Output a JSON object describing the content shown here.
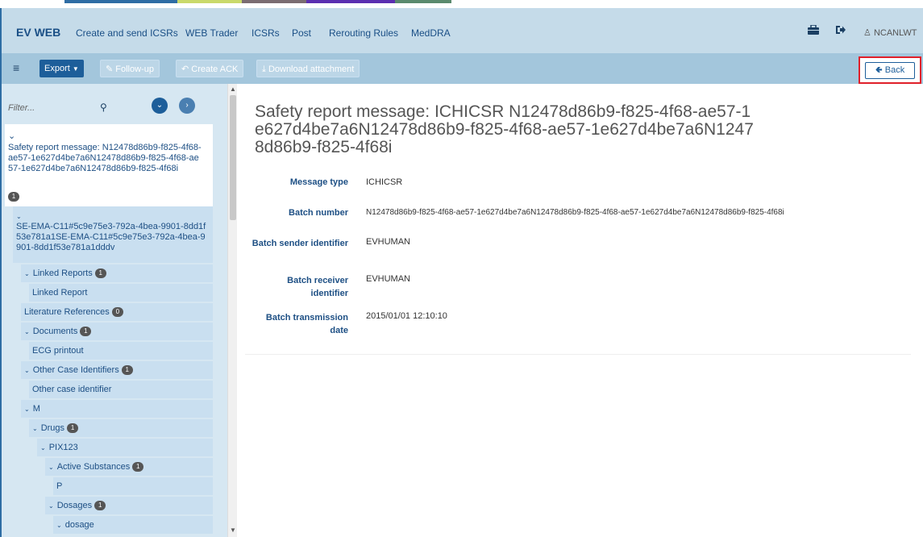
{
  "colors": {
    "nav_bg": "#c5dbe9",
    "toolbar_bg": "#a3c6dc",
    "sidebar_bg": "#d6e7f2",
    "primary": "#1d5e9a",
    "highlight_border": "#e0202a",
    "top_strip": [
      "#2e6da4",
      "#c9d96b",
      "#7a6c72",
      "#5b2fb0",
      "#5a8a6e"
    ]
  },
  "nav": {
    "brand": "EV WEB",
    "links": [
      "Create and send ICSRs",
      "WEB Trader",
      "ICSRs",
      "Post",
      "Rerouting Rules",
      "MedDRA"
    ],
    "user": "NCANLWT",
    "icons": [
      "briefcase-icon",
      "sign-out-icon",
      "user-icon"
    ]
  },
  "toolbar": {
    "menu_icon": "hamburger-icon",
    "export_label": "Export",
    "followup_label": "Follow-up",
    "create_ack_label": "Create ACK",
    "download_label": "Download attachment",
    "back_label": "Back"
  },
  "sidebar": {
    "filter_placeholder": "Filter...",
    "root": {
      "label": "Safety report message: N12478d86b9-f825-4f68-ae57-1e627d4be7a6N12478d86b9-f825-4f68-ae57-1e627d4be7a6N12478d86b9-f825-4f68i",
      "badge": "1"
    },
    "report": {
      "label": "SE-EMA-C11#5c9e75e3-792a-4bea-9901-8dd1f53e781a1SE-EMA-C11#5c9e75e3-792a-4bea-9901-8dd1f53e781a1dddv"
    },
    "items": [
      {
        "label": "Linked Reports",
        "badge": "1",
        "expanded": true
      },
      {
        "label": "Linked Report"
      },
      {
        "label": "Literature References",
        "badge": "0"
      },
      {
        "label": "Documents",
        "badge": "1",
        "expanded": true
      },
      {
        "label": "ECG printout"
      },
      {
        "label": "Other Case Identifiers",
        "badge": "1",
        "expanded": true
      },
      {
        "label": "Other case identifier"
      },
      {
        "label": "M",
        "expanded": true
      },
      {
        "label": "Drugs",
        "badge": "1",
        "expanded": true
      },
      {
        "label": "PIX123",
        "expanded": true
      },
      {
        "label": "Active Substances",
        "badge": "1",
        "expanded": true
      },
      {
        "label": "P"
      },
      {
        "label": "Dosages",
        "badge": "1",
        "expanded": true
      },
      {
        "label": "dosage",
        "expanded": true
      }
    ]
  },
  "main": {
    "title": "Safety report message: ICHICSR N12478d86b9-f825-4f68-ae57-1e627d4be7a6N12478d86b9-f825-4f68-ae57-1e627d4be7a6N12478d86b9-f825-4f68i",
    "fields": [
      {
        "label": "Message type",
        "value": "ICHICSR"
      },
      {
        "label": "Batch number",
        "value": "N12478d86b9-f825-4f68-ae57-1e627d4be7a6N12478d86b9-f825-4f68-ae57-1e627d4be7a6N12478d86b9-f825-4f68i"
      },
      {
        "label": "Batch sender identifier",
        "value": "EVHUMAN"
      },
      {
        "label": "Batch receiver identifier",
        "value": "EVHUMAN"
      },
      {
        "label": "Batch transmission date",
        "value": "2015/01/01 12:10:10"
      }
    ]
  }
}
